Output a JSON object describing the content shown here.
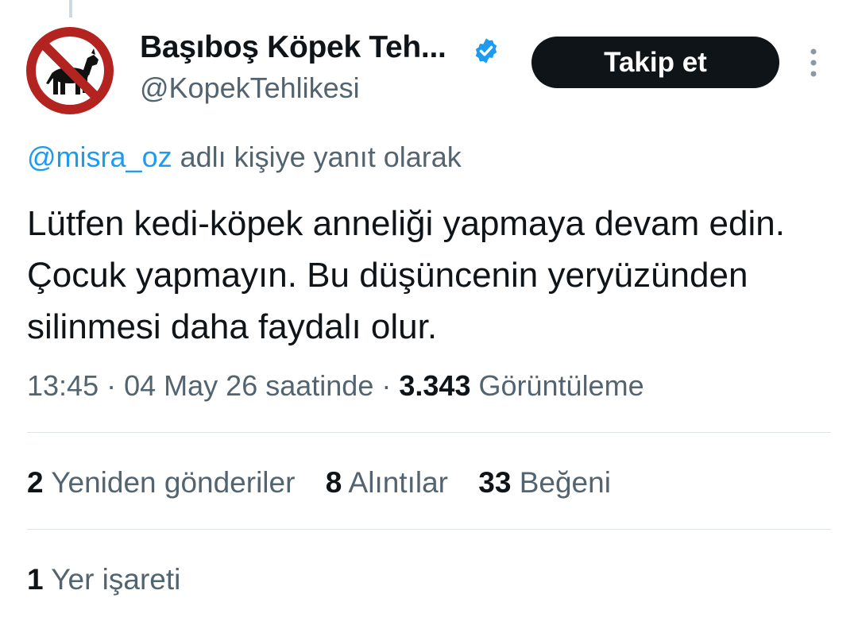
{
  "author": {
    "display_name": "Başıboş Köpek Teh...",
    "handle": "@KopekTehlikesi",
    "verified": true
  },
  "actions": {
    "follow_label": "Takip et",
    "more_icon": "more-vertical-icon"
  },
  "reply_to": {
    "mention": "@misra_oz",
    "suffix": "adlı kişiye yanıt olarak"
  },
  "tweet": {
    "text": "Lütfen kedi-köpek anneliği yapmaya devam edin. Çocuk yapmayın. Bu düşüncenin yeryüzünden silinmesi daha faydalı olur.",
    "time": "13:45",
    "date": "04 May 26 saatinde",
    "separator": "·",
    "views_count": "3.343",
    "views_label": "Görüntüleme"
  },
  "stats": {
    "reposts": {
      "count": "2",
      "label": "Yeniden gönderiler"
    },
    "quotes": {
      "count": "8",
      "label": "Alıntılar"
    },
    "likes": {
      "count": "33",
      "label": "Beğeni"
    },
    "bookmarks": {
      "count": "1",
      "label": "Yer işareti"
    }
  },
  "colors": {
    "accent": "#1d9bf0",
    "text": "#0f1419",
    "secondary_text": "#536471",
    "button_bg": "#0f1419",
    "avatar_ring": "#b3231f"
  }
}
